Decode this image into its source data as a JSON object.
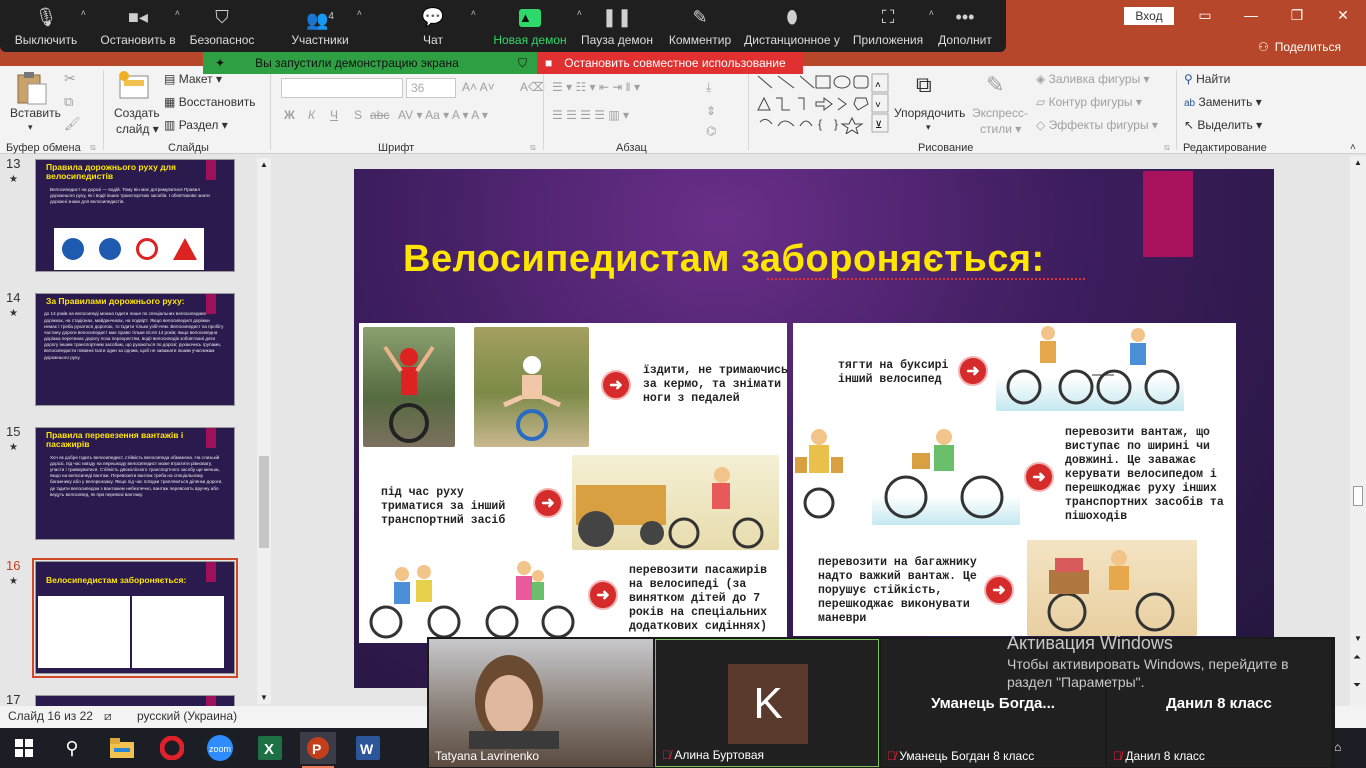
{
  "powerpoint": {
    "signin": "Вход",
    "share": "Поделиться"
  },
  "zoom": {
    "toolbar": [
      {
        "label": "Выключить",
        "icon": "microphone-icon",
        "caret": true
      },
      {
        "label": "Остановить в",
        "icon": "camera-icon",
        "caret": true
      },
      {
        "label": "Безопаснос",
        "icon": "shield-icon"
      },
      {
        "label": "Участники",
        "icon": "participants-icon",
        "count": "4",
        "caret": true
      },
      {
        "label": "Чат",
        "icon": "chat-icon",
        "caret": true
      },
      {
        "label": "Новая демон",
        "icon": "share-screen-icon",
        "caret": true
      },
      {
        "label": "Пауза демон",
        "icon": "pause-icon"
      },
      {
        "label": "Комментир",
        "icon": "pencil-icon"
      },
      {
        "label": "Дистанционное у",
        "icon": "mouse-icon"
      },
      {
        "label": "Приложения",
        "icon": "apps-icon",
        "caret": true
      },
      {
        "label": "Дополнит",
        "icon": "more-icon"
      }
    ],
    "banner_sharing": "Вы запустили демонстрацию экрана",
    "banner_stop": "Остановить совместное использование"
  },
  "ribbon": {
    "clipboard": {
      "paste": "Вставить",
      "group": "Буфер обмена"
    },
    "slides": {
      "new_slide_line1": "Создать",
      "new_slide_line2": "слайд",
      "layout": "Макет",
      "reset": "Восстановить",
      "section": "Раздел",
      "group": "Слайды"
    },
    "font": {
      "size": "36",
      "group": "Шрифт",
      "bold": "Ж",
      "italic": "К",
      "underline": "Ч",
      "strike": "S",
      "abc": "abc"
    },
    "paragraph": {
      "group": "Абзац"
    },
    "drawing": {
      "arrange": "Упорядочить",
      "styles_line1": "Экспресс-",
      "styles_line2": "стили",
      "fill": "Заливка фигуры",
      "outline": "Контур фигуры",
      "effects": "Эффекты фигуры",
      "group": "Рисование"
    },
    "editing": {
      "find": "Найти",
      "replace": "Заменить",
      "select": "Выделить",
      "group": "Редактирование"
    }
  },
  "thumbnails": [
    {
      "num": "13",
      "title": "Правила дорожнього руху для велосипедистів",
      "text": "Велосипедист на дорозі — водій. Тому він має дотримуватися Правил дорожнього руху, як і водії інших транспортних засобів. І обов'язково знати дорожні знаки для велосипедистів."
    },
    {
      "num": "14",
      "title": "За Правилами дорожнього руху:",
      "text": "до 14 років на велосипеді можна їздити лише по спеціальних велосипедних доріжках, на стадіонах, майданчиках, на подвір'ї. Якщо велосипедної доріжки немає і треба рухатися дорогою, то їздити тільки узбіччям. Велосипедист на пробігу частину дороги велосипедист має право тільки після 14 років; якщо велосипедна доріжка перетинає дорогу поза перехрестям, водії велосипедів зобов'язані дати дорогу іншим транспортним засобам, що рухаються по дорозі; рухаючись групами, велосипедисти повинні їхати один за одним, щоб не заважати іншим учасникам дорожнього руху."
    },
    {
      "num": "15",
      "title": "Правила перевезення вантажів і пасажирів",
      "text": "Хоч як добре їздить велосипедист, стійкість велосипеда обмежена. На слизькій дорозі, під час наїзду на перешкоду велосипедист може втратити рівновагу, упасти і травмуватися. Стійкість двоколісного транспортного засобу ще менша, якщо на велосипеді вантаж. Перевозити вантаж треба на спеціальному багажнику або у велорюкзаку. Якщо під час поїздки трапляються ділянки дороги, де їздити велосипедом з вантажем небезпечно, вантаж перевозять вручну або ведуть велосипед, як при перевозі вантажу."
    },
    {
      "num": "16",
      "title": "Велосипедистам забороняється:"
    },
    {
      "num": "17"
    }
  ],
  "slide": {
    "title": "Велосипедистам забороняється:",
    "items": {
      "no_hands": "їздити, не тримаючись за кермо, та знімати ноги з педалей",
      "hold_vehicle": "під час руху триматися за інший транспортний засіб",
      "passengers": "перевозити пасажирів на велосипеді (за винятком дітей до 7 років на спеціальних додаткових сидіннях)",
      "towing": "тягти на буксирі інший велосипед",
      "wide_cargo": "перевозити вантаж, що виступає по ширині чи довжині. Це заважає керувати велосипедом і перешкоджає руху інших транспортних засобів та пішоходів",
      "heavy_cargo": "перевозити на багажнику надто важкий вантаж. Це порушує стійкість, перешкоджає виконувати маневри"
    }
  },
  "status": {
    "slide": "Слайд 16 из 22",
    "language": "русский (Украина)"
  },
  "activation": {
    "title": "Активация Windows",
    "line1": "Чтобы активировать Windows, перейдите в",
    "line2": "раздел \"Параметры\"."
  },
  "video": {
    "tiles": [
      {
        "name": "Tatyana Lavrinenko",
        "muted": false
      },
      {
        "name": "Алина Буртовая",
        "initial": "K",
        "muted": true
      },
      {
        "name": "Уманець Богдан 8 класс",
        "display": "Уманець  Богда...",
        "muted": true
      },
      {
        "name": "Данил 8 класс",
        "display": "Данил 8 класс",
        "muted": true
      }
    ]
  },
  "colors": {
    "powerpoint": "#b7472a",
    "title_yellow": "#ffe600",
    "accent_pink": "#a8115b",
    "zoom_green": "#2ea043",
    "zoom_red": "#e03030"
  }
}
